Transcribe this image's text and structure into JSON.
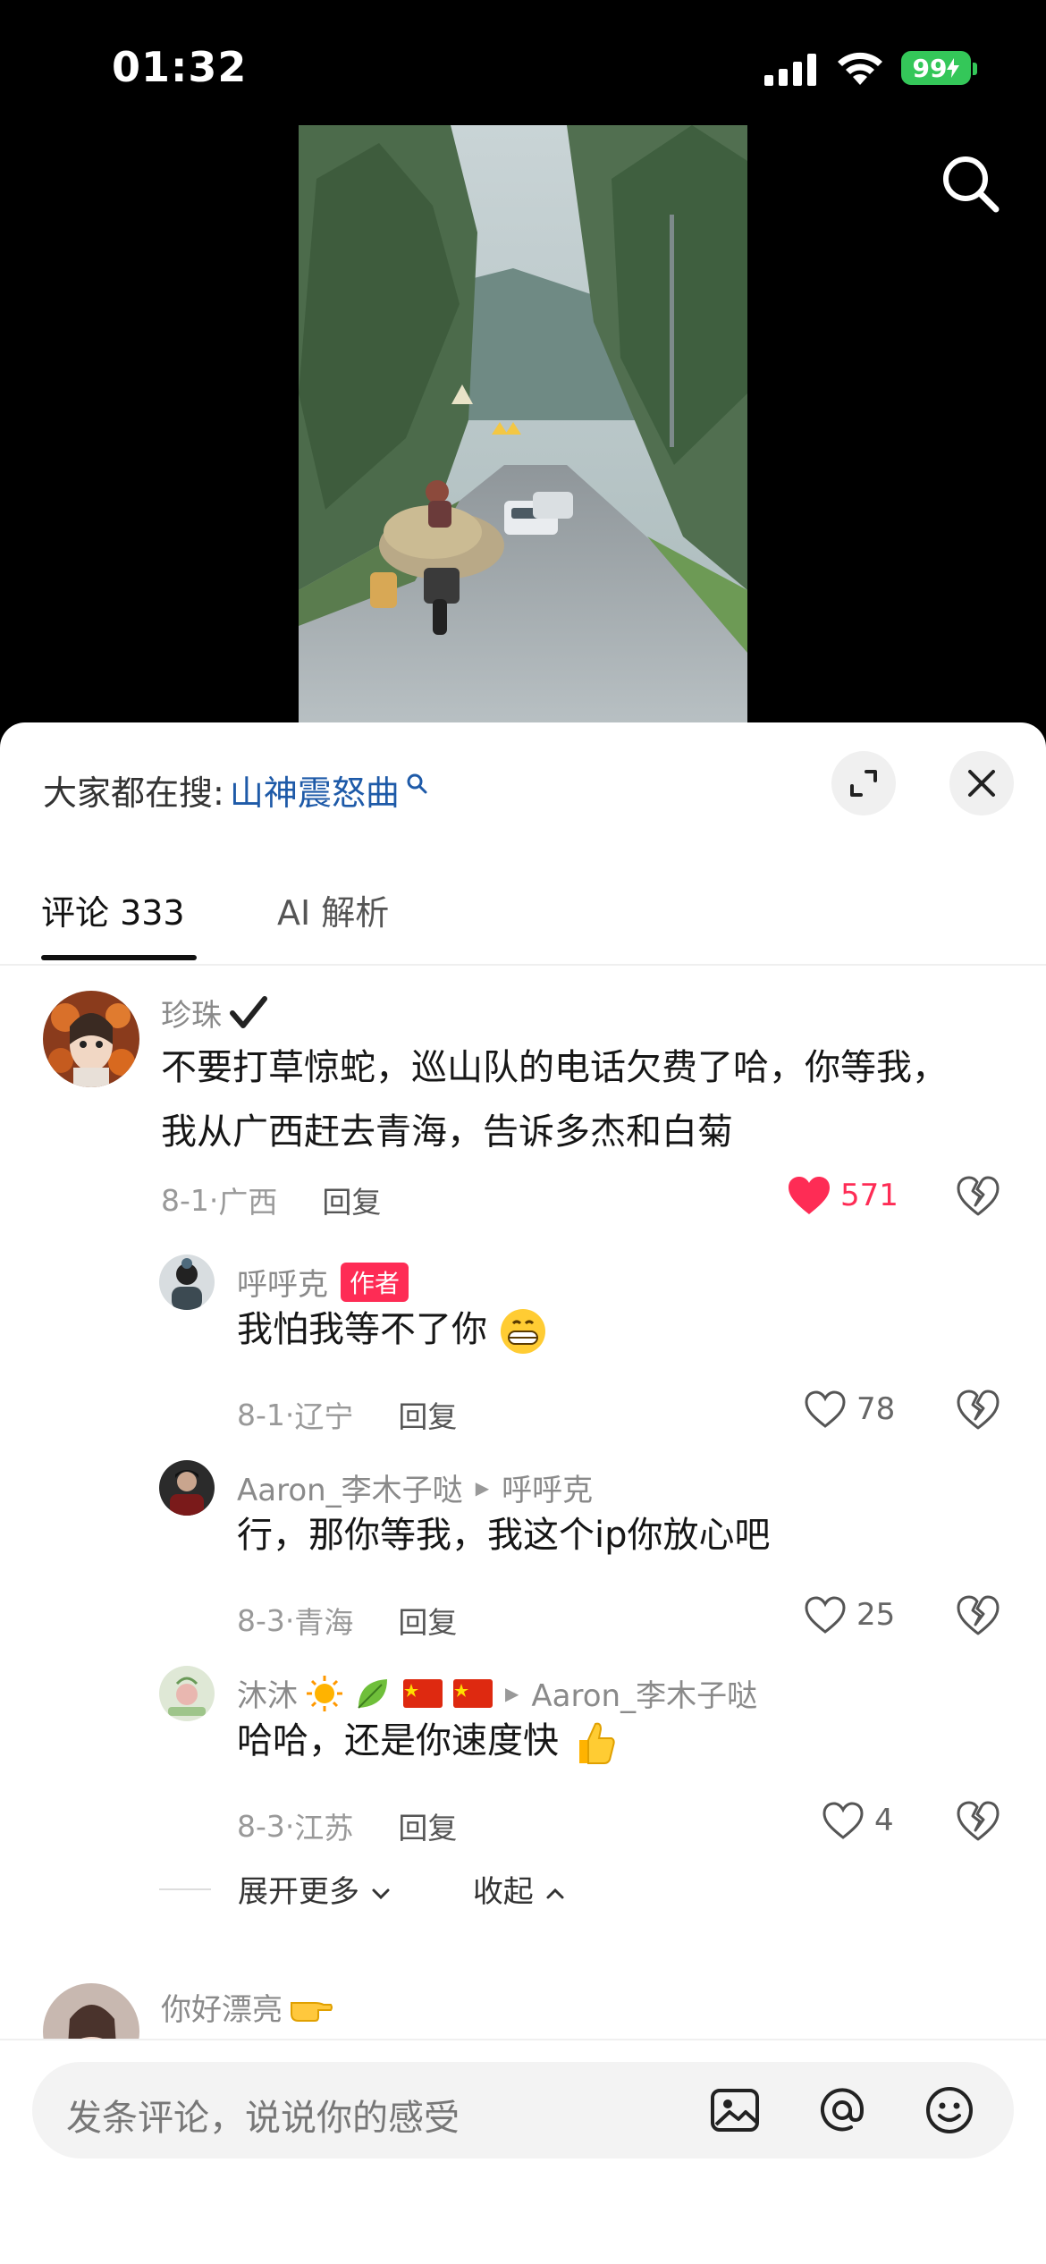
{
  "status_bar": {
    "time": "01:32",
    "battery": "99"
  },
  "sheet": {
    "search_prefix": "大家都在搜:",
    "search_query": "山神震怒曲",
    "tabs": {
      "comments": "评论 333",
      "ai": "AI 解析"
    }
  },
  "comments": [
    {
      "username": "珍珠",
      "text": "不要打草惊蛇，巡山队的电话欠费了哈，你等我，我从广西赶去青海，告诉多杰和白菊",
      "date": "8-1",
      "location": "广西",
      "reply_label": "回复",
      "likes": "571",
      "liked": true
    }
  ],
  "replies": [
    {
      "username": "呼呼克",
      "badge": "作者",
      "text": "我怕我等不了你",
      "emoji": "grinning-face",
      "date": "8-1",
      "location": "辽宁",
      "reply_label": "回复",
      "likes": "78"
    },
    {
      "username": "Aaron_李木子哒",
      "reply_to": "呼呼克",
      "text": "行，那你等我，我这个ip你放心吧",
      "date": "8-3",
      "location": "青海",
      "reply_label": "回复",
      "likes": "25"
    },
    {
      "username": "沐沐",
      "reply_to": "Aaron_李木子哒",
      "text": "哈哈，还是你速度快",
      "emoji": "thumbs-up",
      "date": "8-3",
      "location": "江苏",
      "reply_label": "回复",
      "likes": "4"
    }
  ],
  "expand": {
    "more": "展开更多",
    "collapse": "收起"
  },
  "next_comment": {
    "username": "你好漂亮"
  },
  "input": {
    "placeholder": "发条评论，说说你的感受"
  },
  "colors": {
    "accent": "#fe2c55",
    "link": "#1e5aa8",
    "battery": "#34c759"
  }
}
